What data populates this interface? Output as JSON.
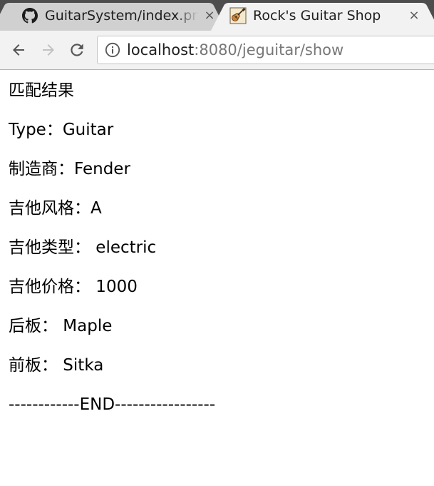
{
  "browser": {
    "tabs": [
      {
        "title": "GuitarSystem/index.png",
        "icon": "github-icon",
        "active": false
      },
      {
        "title": "Rock's Guitar Shop",
        "icon": "guitar-shop-favicon",
        "active": true
      }
    ],
    "close_glyph": "×",
    "address": {
      "host": "localhost",
      "rest": ":8080/jeguitar/show"
    }
  },
  "content": {
    "heading": "匹配结果",
    "lines": [
      "Type：Guitar",
      "制造商：Fender",
      "吉他风格：A",
      "吉他类型： electric",
      "吉他价格： 1000",
      "后板： Maple",
      "前板： Sitka"
    ],
    "footer": "------------END-----------------"
  },
  "colors": {
    "tabstrip_bg": "#4d4d4d",
    "active_tab": "#f2f2f2",
    "inactive_tab": "#d0d0d0",
    "toolbar_bg": "#f2f2f2"
  }
}
